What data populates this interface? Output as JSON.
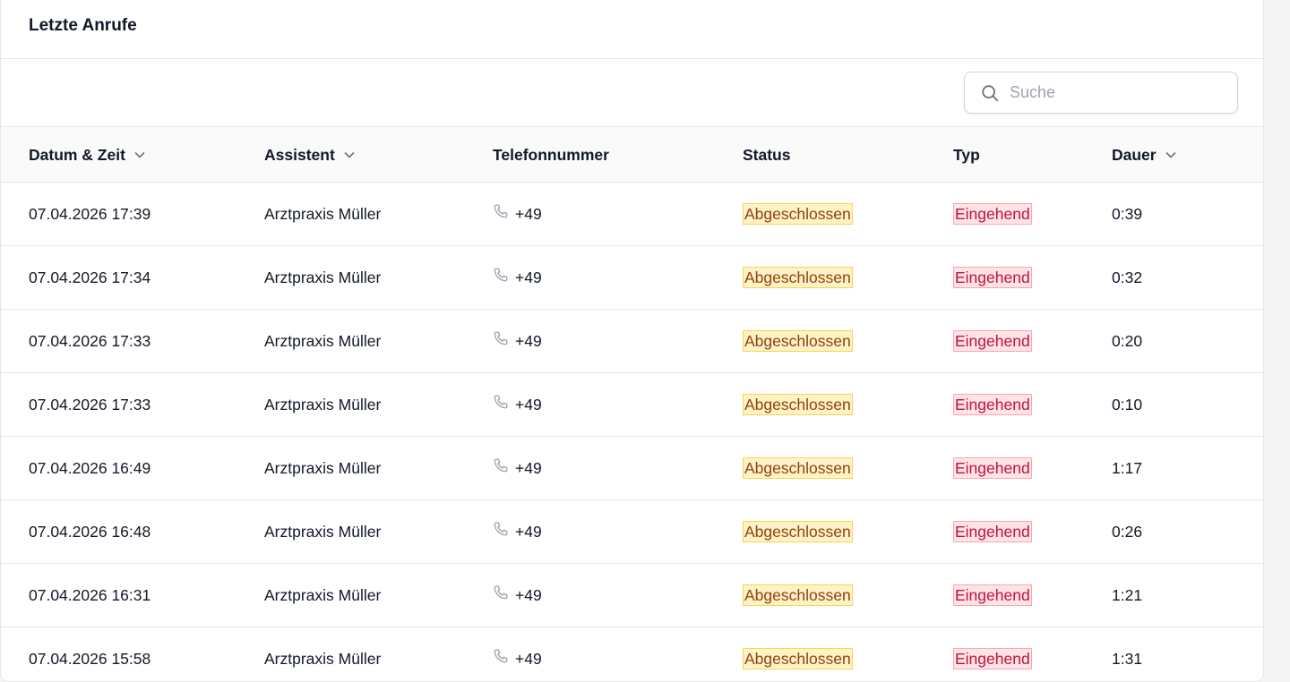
{
  "card": {
    "title": "Letzte Anrufe"
  },
  "search": {
    "placeholder": "Suche",
    "value": ""
  },
  "columns": {
    "date": "Datum & Zeit",
    "assistant": "Assistent",
    "phone": "Telefonnummer",
    "status": "Status",
    "type": "Typ",
    "duration": "Dauer"
  },
  "rows": [
    {
      "date": "07.04.2026 17:39",
      "assistant": "Arztpraxis Müller",
      "phone": "+49",
      "status": "Abgeschlossen",
      "type": "Eingehend",
      "duration": "0:39"
    },
    {
      "date": "07.04.2026 17:34",
      "assistant": "Arztpraxis Müller",
      "phone": "+49",
      "status": "Abgeschlossen",
      "type": "Eingehend",
      "duration": "0:32"
    },
    {
      "date": "07.04.2026 17:33",
      "assistant": "Arztpraxis Müller",
      "phone": "+49",
      "status": "Abgeschlossen",
      "type": "Eingehend",
      "duration": "0:20"
    },
    {
      "date": "07.04.2026 17:33",
      "assistant": "Arztpraxis Müller",
      "phone": "+49",
      "status": "Abgeschlossen",
      "type": "Eingehend",
      "duration": "0:10"
    },
    {
      "date": "07.04.2026 16:49",
      "assistant": "Arztpraxis Müller",
      "phone": "+49",
      "status": "Abgeschlossen",
      "type": "Eingehend",
      "duration": "1:17"
    },
    {
      "date": "07.04.2026 16:48",
      "assistant": "Arztpraxis Müller",
      "phone": "+49",
      "status": "Abgeschlossen",
      "type": "Eingehend",
      "duration": "0:26"
    },
    {
      "date": "07.04.2026 16:31",
      "assistant": "Arztpraxis Müller",
      "phone": "+49",
      "status": "Abgeschlossen",
      "type": "Eingehend",
      "duration": "1:21"
    },
    {
      "date": "07.04.2026 15:58",
      "assistant": "Arztpraxis Müller",
      "phone": "+49",
      "status": "Abgeschlossen",
      "type": "Eingehend",
      "duration": "1:31"
    }
  ],
  "icons": {
    "search": "search-icon",
    "sort": "chevron-down-icon",
    "phone": "phone-icon"
  },
  "colors": {
    "status_bg": "#fef3c7",
    "status_text": "#92400e",
    "type_bg": "#ffe4e6",
    "type_text": "#be123c"
  }
}
